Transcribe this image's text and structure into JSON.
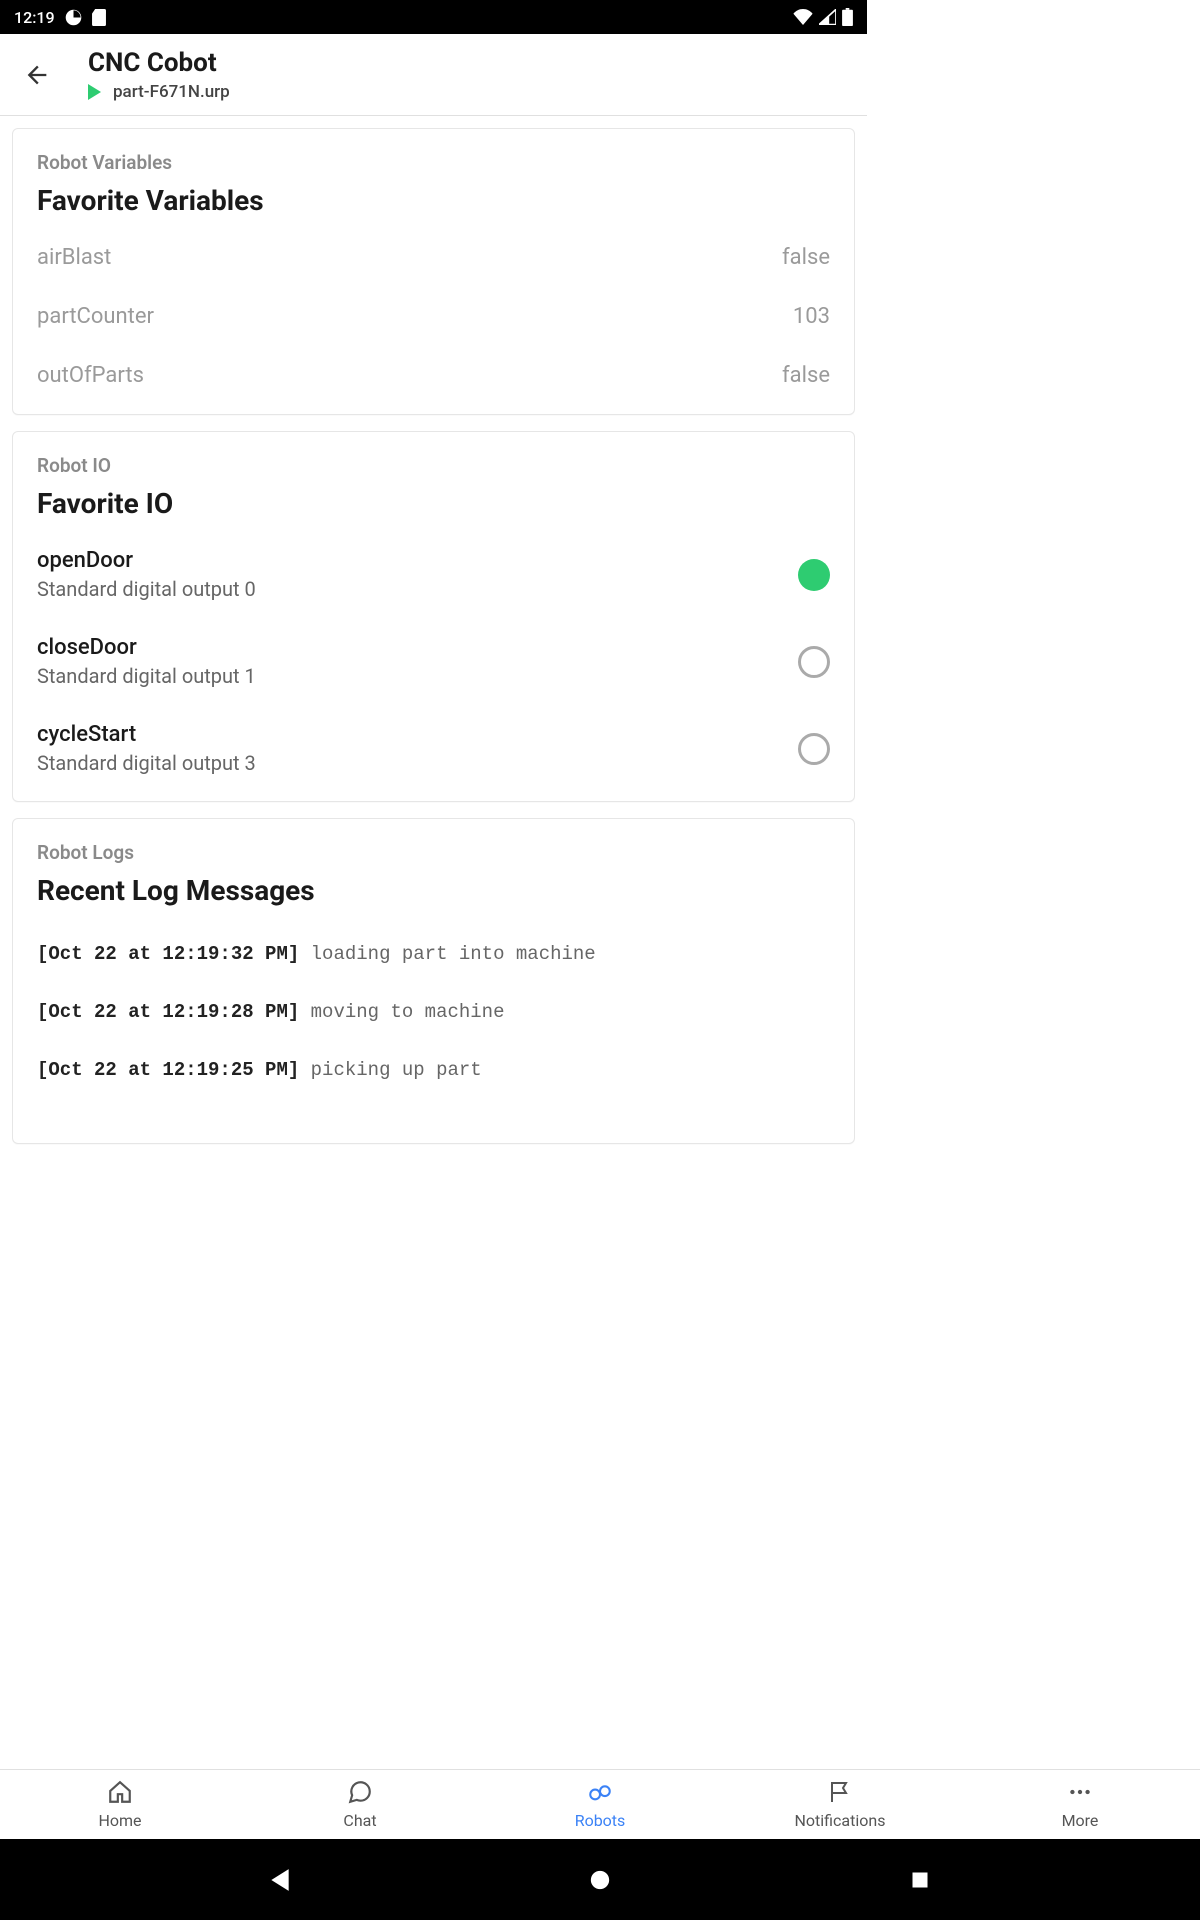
{
  "status_bar": {
    "time": "12:19"
  },
  "header": {
    "title": "CNC Cobot",
    "subtitle": "part-F671N.urp"
  },
  "variables_card": {
    "eyebrow": "Robot Variables",
    "title": "Favorite Variables",
    "rows": [
      {
        "name": "airBlast",
        "value": "false"
      },
      {
        "name": "partCounter",
        "value": "103"
      },
      {
        "name": "outOfParts",
        "value": "false"
      }
    ]
  },
  "io_card": {
    "eyebrow": "Robot IO",
    "title": "Favorite IO",
    "rows": [
      {
        "name": "openDoor",
        "sub": "Standard digital output 0",
        "on": true
      },
      {
        "name": "closeDoor",
        "sub": "Standard digital output 1",
        "on": false
      },
      {
        "name": "cycleStart",
        "sub": "Standard digital output 3",
        "on": false
      }
    ]
  },
  "logs_card": {
    "eyebrow": "Robot Logs",
    "title": "Recent Log Messages",
    "rows": [
      {
        "time": "[Oct 22 at 12:19:32 PM]",
        "msg": " loading part into machine"
      },
      {
        "time": "[Oct 22 at 12:19:28 PM]",
        "msg": " moving to machine"
      },
      {
        "time": "[Oct 22 at 12:19:25 PM]",
        "msg": " picking up part"
      }
    ]
  },
  "nav": {
    "items": [
      {
        "label": "Home"
      },
      {
        "label": "Chat"
      },
      {
        "label": "Robots"
      },
      {
        "label": "Notifications"
      },
      {
        "label": "More"
      }
    ],
    "active_index": 2
  }
}
